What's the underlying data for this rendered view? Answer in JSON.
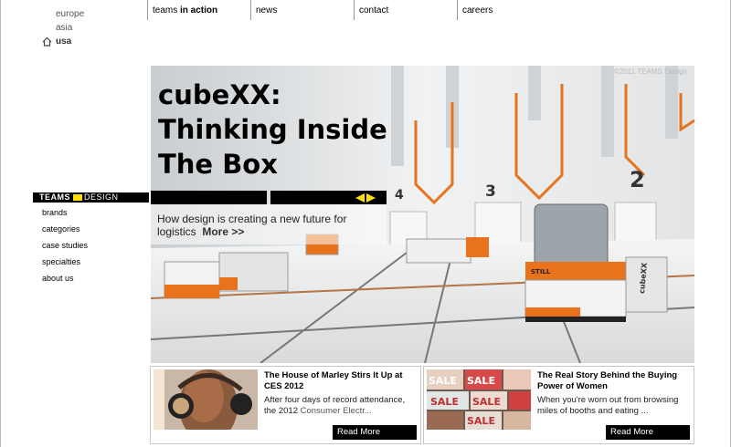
{
  "regions": [
    "europe",
    "asia",
    "usa"
  ],
  "nav": {
    "teams_prefix": "teams ",
    "teams_bold": "in action",
    "news": "news",
    "contact": "contact",
    "careers": "careers"
  },
  "sidebar": {
    "header_teams": "TEAMS",
    "header_design": "DESIGN",
    "items": [
      {
        "label": "brands"
      },
      {
        "label": "categories"
      },
      {
        "label": "case studies"
      },
      {
        "label": "specialties"
      },
      {
        "label": "about us"
      }
    ]
  },
  "hero": {
    "title_line1": "cubeXX:",
    "title_line2": "Thinking Inside",
    "title_line3": "The Box",
    "description": "How design is creating a new future for logistics",
    "more": "More >>",
    "copyright": "©2011 TEAMS Design",
    "bay_numbers": [
      "4",
      "3",
      "2"
    ],
    "vehicle_brand": "STILL",
    "vehicle_model": "cubeXX"
  },
  "news": [
    {
      "title": "The House of Marley Stirs It Up at CES 2012",
      "body": "After four days of record attendance, the 2012",
      "body_more": "Consumer Electr...",
      "readmore": "Read More"
    },
    {
      "title": "The Real Story Behind the Buying Power of Women",
      "body": "When you're worn out from browsing miles of booths and eating ...",
      "body_more": "",
      "readmore": "Read More",
      "thumb_sign": "SALE"
    }
  ],
  "colors": {
    "accent_yellow": "#ffe100",
    "orange": "#e8731c"
  }
}
